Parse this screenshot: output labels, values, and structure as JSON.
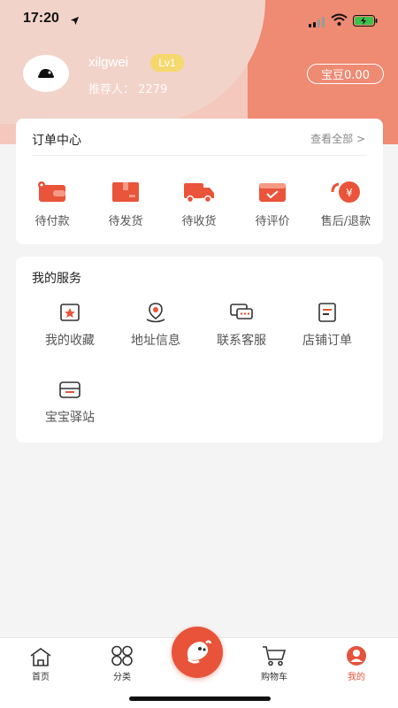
{
  "status_bar": {
    "time": "17:20"
  },
  "profile": {
    "username": "xilgwei",
    "level": "Lv1",
    "referrer_label": "推荐人：",
    "referrer_value": "2279",
    "beans": "宝豆0.00"
  },
  "orders": {
    "title": "订单中心",
    "view_all": "查看全部 >",
    "items": [
      {
        "label": "待付款",
        "icon": "wallet-icon"
      },
      {
        "label": "待发货",
        "icon": "package-icon"
      },
      {
        "label": "待收货",
        "icon": "truck-icon"
      },
      {
        "label": "待评价",
        "icon": "review-box-icon"
      },
      {
        "label": "售后/退款",
        "icon": "refund-icon"
      }
    ]
  },
  "services": {
    "title": "我的服务",
    "items": [
      {
        "label": "我的收藏",
        "icon": "favorite-icon"
      },
      {
        "label": "地址信息",
        "icon": "location-icon"
      },
      {
        "label": "联系客服",
        "icon": "chat-icon"
      },
      {
        "label": "店铺订单",
        "icon": "store-order-icon"
      },
      {
        "label": "宝宝驿站",
        "icon": "station-icon"
      }
    ]
  },
  "tabbar": {
    "items": [
      {
        "label": "首页",
        "icon": "home-icon"
      },
      {
        "label": "分类",
        "icon": "category-icon"
      },
      {
        "label": "购物车",
        "icon": "cart-icon"
      },
      {
        "label": "我的",
        "icon": "user-icon",
        "active": true
      }
    ]
  },
  "colors": {
    "accent": "#e5533c",
    "header_light": "#f2d3ca",
    "header_dark": "#ef8a73",
    "level_badge": "#f6d86e"
  }
}
